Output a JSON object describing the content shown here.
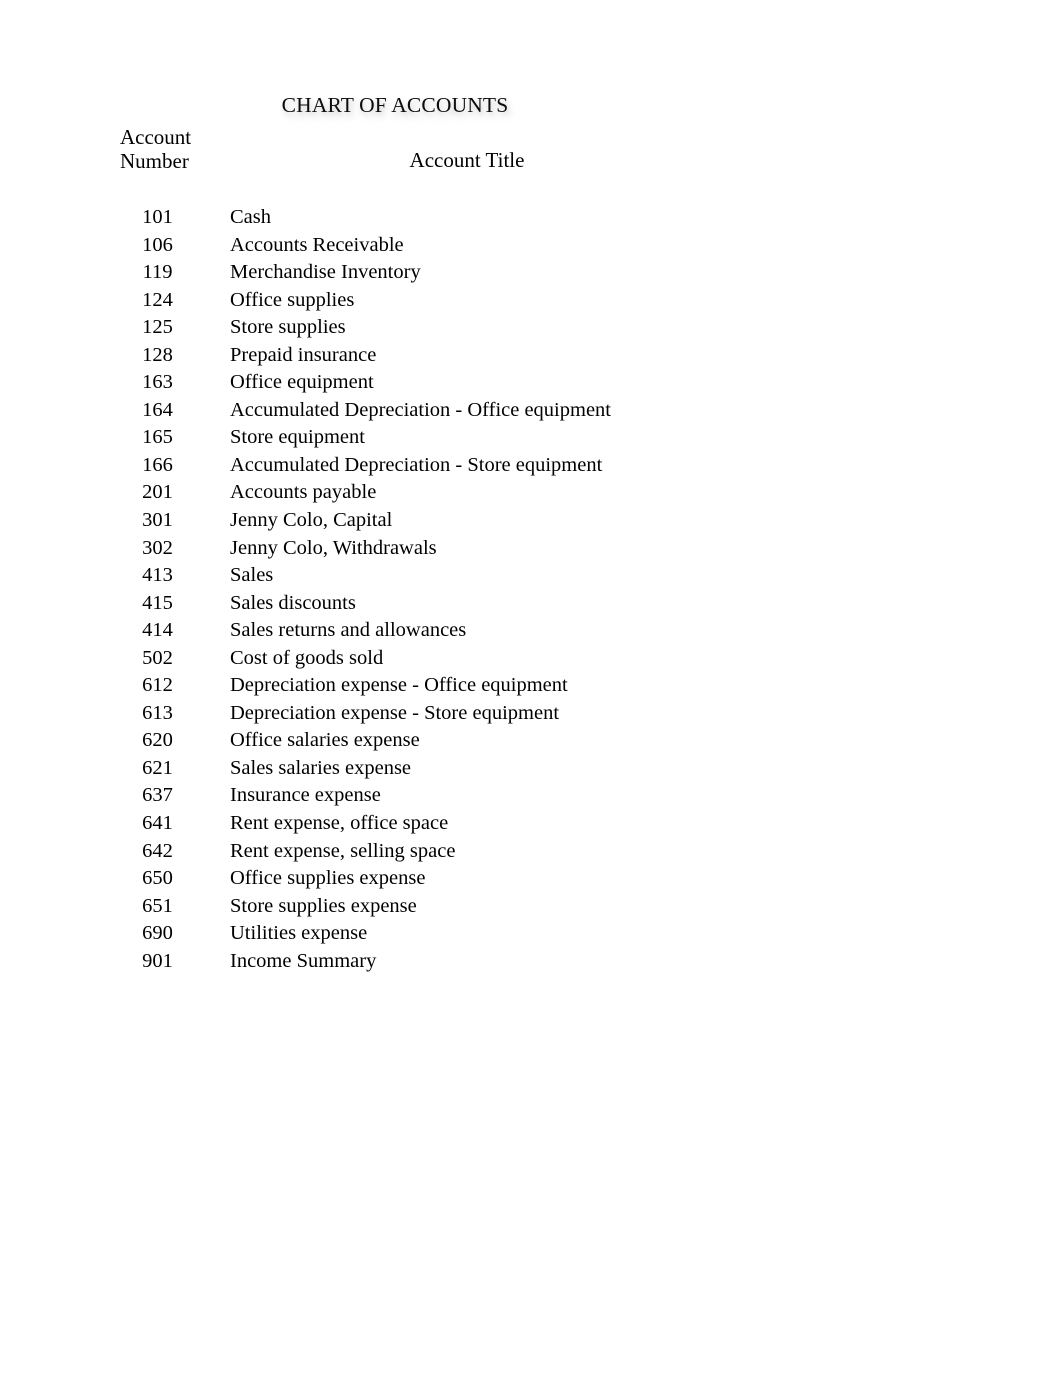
{
  "document": {
    "title": "CHART OF ACCOUNTS",
    "headers": {
      "account_number": "Account\nNumber",
      "account_number_line1": "Account",
      "account_number_line2": "Number",
      "account_title": "Account Title"
    }
  },
  "accounts": [
    {
      "number": "101",
      "title": "Cash"
    },
    {
      "number": "106",
      "title": "Accounts Receivable"
    },
    {
      "number": "119",
      "title": "Merchandise Inventory"
    },
    {
      "number": "124",
      "title": "Office supplies"
    },
    {
      "number": "125",
      "title": "Store supplies"
    },
    {
      "number": "128",
      "title": "Prepaid insurance"
    },
    {
      "number": "163",
      "title": "Office equipment"
    },
    {
      "number": "164",
      "title": "Accumulated Depreciation - Office equipment"
    },
    {
      "number": "165",
      "title": "Store equipment"
    },
    {
      "number": "166",
      "title": "Accumulated Depreciation - Store equipment"
    },
    {
      "number": "201",
      "title": "Accounts payable"
    },
    {
      "number": "301",
      "title": "Jenny Colo, Capital"
    },
    {
      "number": "302",
      "title": "Jenny Colo, Withdrawals"
    },
    {
      "number": "413",
      "title": "Sales"
    },
    {
      "number": "415",
      "title": "Sales discounts"
    },
    {
      "number": "414",
      "title": "Sales returns and allowances"
    },
    {
      "number": "502",
      "title": "Cost of goods sold"
    },
    {
      "number": "612",
      "title": "Depreciation expense - Office equipment"
    },
    {
      "number": "613",
      "title": "Depreciation expense - Store equipment"
    },
    {
      "number": "620",
      "title": "Office salaries expense"
    },
    {
      "number": "621",
      "title": "Sales salaries expense"
    },
    {
      "number": "637",
      "title": "Insurance expense"
    },
    {
      "number": "641",
      "title": "Rent expense, office space"
    },
    {
      "number": "642",
      "title": "Rent expense, selling space"
    },
    {
      "number": "650",
      "title": "Office supplies expense"
    },
    {
      "number": "651",
      "title": "Store supplies expense"
    },
    {
      "number": "690",
      "title": "Utilities expense"
    },
    {
      "number": "901",
      "title": "Income Summary"
    }
  ]
}
